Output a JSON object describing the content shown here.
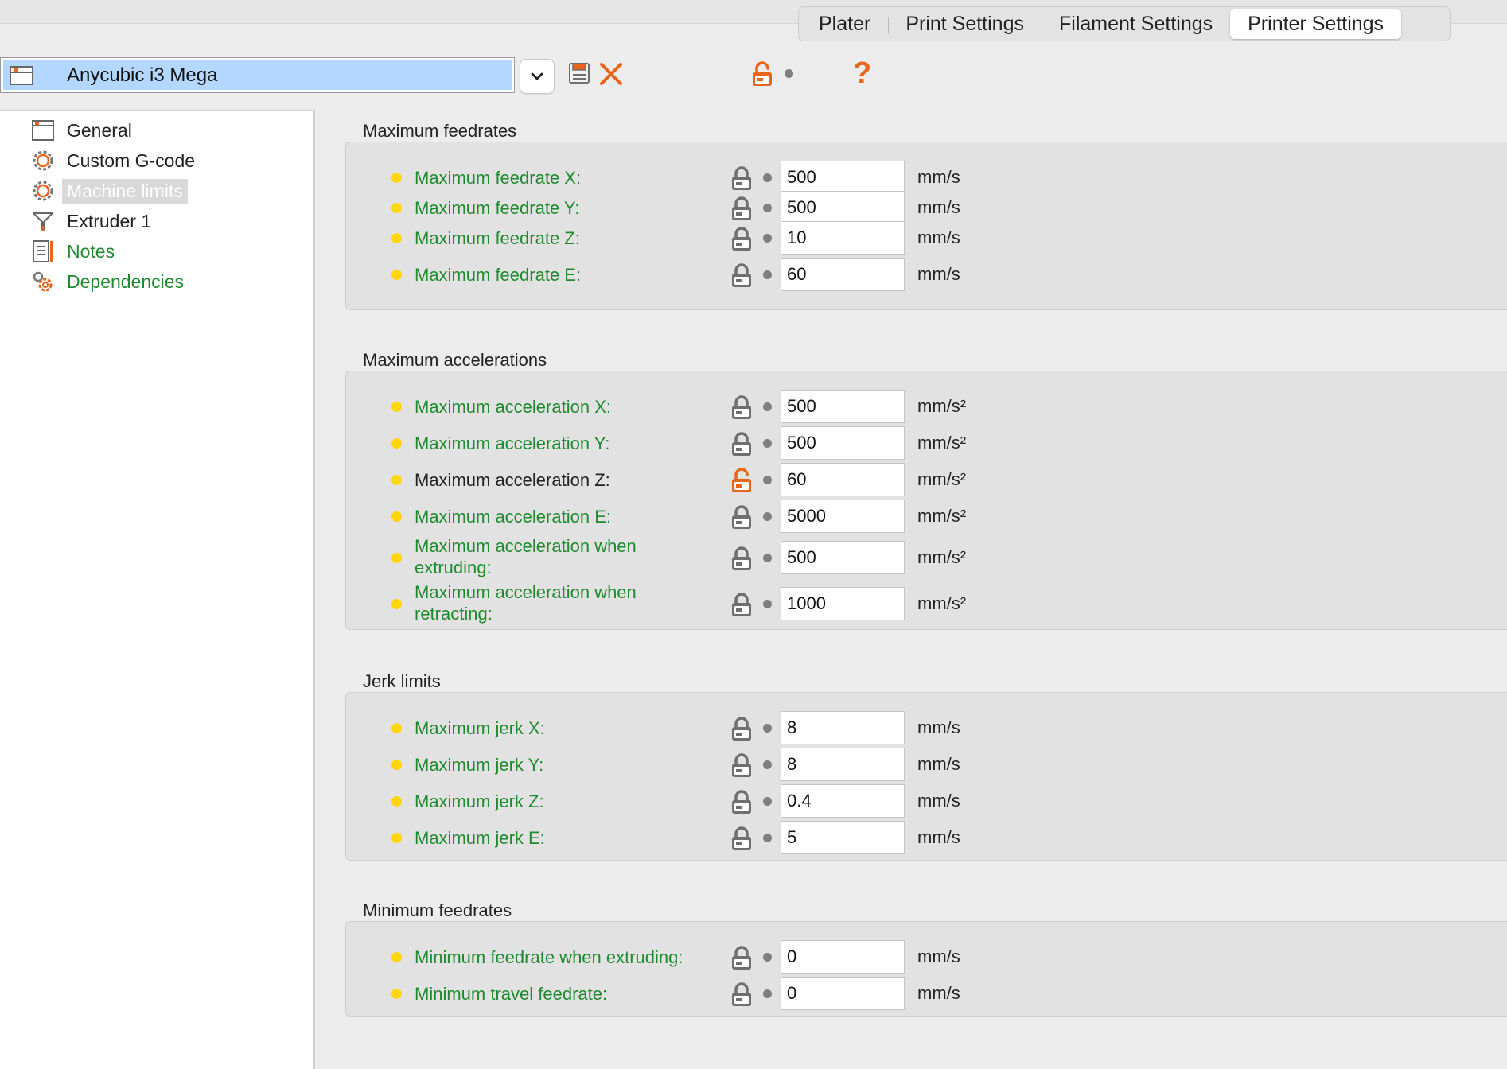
{
  "tabs": [
    {
      "label": "Plater"
    },
    {
      "label": "Print Settings"
    },
    {
      "label": "Filament Settings"
    },
    {
      "label": "Printer Settings"
    }
  ],
  "preset": {
    "name": "Anycubic i3 Mega"
  },
  "toolbar": {
    "help_label": "?"
  },
  "colors": {
    "accent": "#e8651a",
    "modified_green": "#1f8a2f",
    "bullet_yellow": "#ffd60a",
    "lock_gray": "#6f6f6f",
    "selection": "#b3d7ff"
  },
  "sidebar": {
    "items": [
      {
        "label": "General",
        "icon": "printer-icon"
      },
      {
        "label": "Custom G-code",
        "icon": "gear-icon"
      },
      {
        "label": "Machine limits",
        "icon": "gear-icon"
      },
      {
        "label": "Extruder 1",
        "icon": "funnel-icon"
      },
      {
        "label": "Notes",
        "icon": "note-icon"
      },
      {
        "label": "Dependencies",
        "icon": "wrench-icon"
      }
    ]
  },
  "groups": [
    {
      "title": "Maximum feedrates",
      "rows": [
        {
          "label": "Maximum feedrate X:",
          "value": "500",
          "unit": "mm/s"
        },
        {
          "label": "Maximum feedrate Y:",
          "value": "500",
          "unit": "mm/s"
        },
        {
          "label": "Maximum feedrate Z:",
          "value": "10",
          "unit": "mm/s"
        },
        {
          "label": "Maximum feedrate E:",
          "value": "60",
          "unit": "mm/s"
        }
      ]
    },
    {
      "title": "Maximum accelerations",
      "rows": [
        {
          "label": "Maximum acceleration X:",
          "value": "500",
          "unit": "mm/s²"
        },
        {
          "label": "Maximum acceleration Y:",
          "value": "500",
          "unit": "mm/s²"
        },
        {
          "label": "Maximum acceleration Z:",
          "value": "60",
          "unit": "mm/s²"
        },
        {
          "label": "Maximum acceleration E:",
          "value": "5000",
          "unit": "mm/s²"
        },
        {
          "label": "Maximum acceleration when extruding:",
          "value": "500",
          "unit": "mm/s²"
        },
        {
          "label": "Maximum acceleration when retracting:",
          "value": "1000",
          "unit": "mm/s²"
        }
      ]
    },
    {
      "title": "Jerk limits",
      "rows": [
        {
          "label": "Maximum jerk X:",
          "value": "8",
          "unit": "mm/s"
        },
        {
          "label": "Maximum jerk Y:",
          "value": "8",
          "unit": "mm/s"
        },
        {
          "label": "Maximum jerk Z:",
          "value": "0.4",
          "unit": "mm/s"
        },
        {
          "label": "Maximum jerk E:",
          "value": "5",
          "unit": "mm/s"
        }
      ]
    },
    {
      "title": "Minimum feedrates",
      "rows": [
        {
          "label": "Minimum feedrate when extruding:",
          "value": "0",
          "unit": "mm/s"
        },
        {
          "label": "Minimum travel feedrate:",
          "value": "0",
          "unit": "mm/s"
        }
      ]
    }
  ]
}
